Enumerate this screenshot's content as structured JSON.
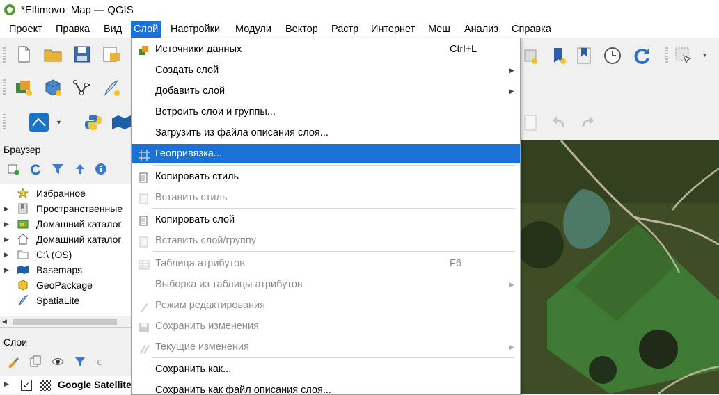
{
  "window": {
    "title": "*Elfimovo_Map — QGIS"
  },
  "menubar": {
    "items": [
      "Проект",
      "Правка",
      "Вид",
      "Слой",
      "Настройки",
      "Модули",
      "Вектор",
      "Растр",
      "Интернет",
      "Меш",
      "Анализ",
      "Справка"
    ],
    "active": "Слой"
  },
  "browser_panel": {
    "title": "Браузер",
    "items": [
      {
        "label": "Избранное",
        "icon": "star-icon"
      },
      {
        "label": "Пространственные",
        "icon": "bookmark-icon"
      },
      {
        "label": "Домашний каталог",
        "icon": "home-folder-icon"
      },
      {
        "label": "Домашний каталог",
        "icon": "home-icon"
      },
      {
        "label": "C:\\ (OS)",
        "icon": "folder-icon"
      },
      {
        "label": "Basemaps",
        "icon": "basemaps-icon"
      },
      {
        "label": "GeoPackage",
        "icon": "geopackage-icon"
      },
      {
        "label": "SpatiaLite",
        "icon": "feather-icon"
      }
    ]
  },
  "layers_panel": {
    "title": "Слои",
    "layers": [
      {
        "label": "Google Satellite",
        "checked": true
      }
    ]
  },
  "layer_menu": {
    "items": [
      {
        "label": "Источники данных",
        "shortcut": "Ctrl+L",
        "submenu": false,
        "disabled": false,
        "icon": "data-source-icon"
      },
      {
        "label": "Создать слой",
        "shortcut": "",
        "submenu": true,
        "disabled": false,
        "icon": ""
      },
      {
        "label": "Добавить слой",
        "shortcut": "",
        "submenu": true,
        "disabled": false,
        "icon": ""
      },
      {
        "label": "Встроить слои и группы...",
        "shortcut": "",
        "submenu": false,
        "disabled": false,
        "icon": ""
      },
      {
        "label": "Загрузить из файла описания слоя...",
        "shortcut": "",
        "submenu": false,
        "disabled": false,
        "icon": ""
      },
      {
        "label": "Геопривязка...",
        "shortcut": "",
        "submenu": false,
        "disabled": false,
        "highlighted": true,
        "icon": "georeference-icon"
      },
      {
        "label": "Копировать стиль",
        "shortcut": "",
        "submenu": false,
        "disabled": false,
        "icon": "copy-icon"
      },
      {
        "label": "Вставить стиль",
        "shortcut": "",
        "submenu": false,
        "disabled": true,
        "icon": "paste-icon"
      },
      {
        "label": "Копировать слой",
        "shortcut": "",
        "submenu": false,
        "disabled": false,
        "icon": "copy-icon"
      },
      {
        "label": "Вставить слой/группу",
        "shortcut": "",
        "submenu": false,
        "disabled": true,
        "icon": "paste-icon"
      },
      {
        "label": "Таблица атрибутов",
        "shortcut": "F6",
        "submenu": false,
        "disabled": true,
        "icon": "table-icon"
      },
      {
        "label": "Выборка из таблицы атрибутов",
        "shortcut": "",
        "submenu": true,
        "disabled": true,
        "icon": ""
      },
      {
        "label": "Режим редактирования",
        "shortcut": "",
        "submenu": false,
        "disabled": true,
        "icon": "pencil-icon"
      },
      {
        "label": "Сохранить изменения",
        "shortcut": "",
        "submenu": false,
        "disabled": true,
        "icon": "save-icon"
      },
      {
        "label": "Текущие изменения",
        "shortcut": "",
        "submenu": true,
        "disabled": true,
        "icon": "pencils-icon"
      },
      {
        "label": "Сохранить как...",
        "shortcut": "",
        "submenu": false,
        "disabled": false,
        "icon": ""
      },
      {
        "label": "Сохранить как файл описания слоя...",
        "shortcut": "",
        "submenu": false,
        "disabled": false,
        "icon": ""
      }
    ]
  },
  "colors": {
    "accent": "#1b72d6",
    "qgis_green": "#5a9a32",
    "disabled_text": "#8c8c8c"
  }
}
